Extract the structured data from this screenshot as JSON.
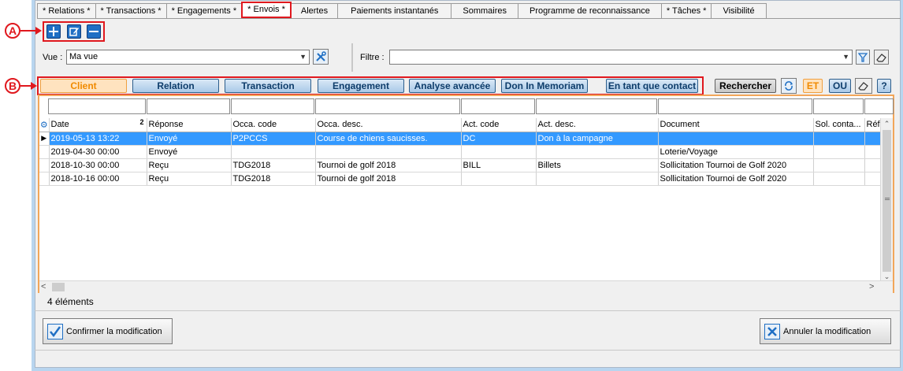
{
  "tabs": [
    {
      "label": "* Relations *"
    },
    {
      "label": "* Transactions *"
    },
    {
      "label": "* Engagements *"
    },
    {
      "label": "* Envois *"
    },
    {
      "label": "Alertes"
    },
    {
      "label": "Paiements instantanés"
    },
    {
      "label": "Sommaires"
    },
    {
      "label": "Programme de reconnaissance"
    },
    {
      "label": "* Tâches *"
    },
    {
      "label": "Visibilité"
    }
  ],
  "annotations": {
    "a": "A",
    "b": "B"
  },
  "toolbar": {
    "add_icon": "plus-icon",
    "edit_icon": "edit-icon",
    "remove_icon": "minus-icon"
  },
  "view": {
    "label": "Vue :",
    "value": "Ma vue"
  },
  "filter": {
    "label": "Filtre :",
    "value": ""
  },
  "categories": [
    {
      "label": "Client",
      "active": true
    },
    {
      "label": "Relation"
    },
    {
      "label": "Transaction"
    },
    {
      "label": "Engagement"
    },
    {
      "label": "Analyse avancée"
    },
    {
      "label": "Don In Memoriam"
    },
    {
      "label": "En tant que contact"
    }
  ],
  "search": {
    "label": "Rechercher",
    "and_label": "ET",
    "or_label": "OU",
    "help_label": "?"
  },
  "grid": {
    "sort_indicator": "2",
    "columns": [
      "Date",
      "Réponse",
      "Occa. code",
      "Occa. desc.",
      "Act. code",
      "Act. desc.",
      "Document",
      "Sol. conta...",
      "Réf"
    ],
    "rows": [
      [
        "2019-05-13 13:22",
        "Envoyé",
        "P2PCCS",
        "Course de chiens saucisses.",
        "DC",
        "Don à la campagne",
        "",
        "",
        ""
      ],
      [
        "2019-04-30 00:00",
        "Envoyé",
        "",
        "",
        "",
        "",
        "Loterie/Voyage",
        "",
        ""
      ],
      [
        "2018-10-30 00:00",
        "Reçu",
        "TDG2018",
        "Tournoi de golf 2018",
        "BILL",
        "Billets",
        "Sollicitation Tournoi de Golf 2020",
        "",
        ""
      ],
      [
        "2018-10-16 00:00",
        "Reçu",
        "TDG2018",
        "Tournoi de golf 2018",
        "",
        "",
        "Sollicitation Tournoi de Golf 2020",
        "",
        ""
      ]
    ]
  },
  "status": {
    "count": "4 éléments"
  },
  "actions": {
    "confirm": "Confirmer la modification",
    "cancel": "Annuler la modification"
  },
  "colors": {
    "accent": "#e0181e",
    "selection": "#3399ff",
    "active_category": "#f08a00"
  }
}
